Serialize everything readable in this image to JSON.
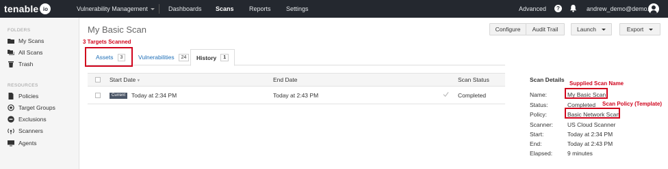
{
  "app": {
    "logo_text": "tenable",
    "logo_badge": "io",
    "product": "Vulnerability Management",
    "nav": [
      "Dashboards",
      "Scans",
      "Reports",
      "Settings"
    ],
    "advanced": "Advanced",
    "help_glyph": "?",
    "user": "andrew_demo@demo...",
    "icons": {
      "help": "help-icon",
      "notifications": "bell-icon",
      "user": "user-avatar-icon"
    }
  },
  "sidebar": {
    "folders_heading": "FOLDERS",
    "folders": [
      {
        "label": "My Scans",
        "icon": "folder-icon"
      },
      {
        "label": "All Scans",
        "icon": "folders-icon"
      },
      {
        "label": "Trash",
        "icon": "trash-icon"
      }
    ],
    "resources_heading": "RESOURCES",
    "resources": [
      {
        "label": "Policies",
        "icon": "document-icon"
      },
      {
        "label": "Target Groups",
        "icon": "target-icon"
      },
      {
        "label": "Exclusions",
        "icon": "minus-circle-icon"
      },
      {
        "label": "Scanners",
        "icon": "antenna-icon"
      },
      {
        "label": "Agents",
        "icon": "monitor-icon"
      }
    ]
  },
  "page": {
    "title": "My Basic Scan",
    "buttons": {
      "configure": "Configure",
      "audit_trail": "Audit Trail",
      "launch": "Launch",
      "export": "Export"
    }
  },
  "tabs": [
    {
      "label": "Assets",
      "count": "3"
    },
    {
      "label": "Vulnerabilities",
      "count": "24"
    },
    {
      "label": "History",
      "count": "1"
    }
  ],
  "history_table": {
    "columns": [
      "Start Date",
      "End Date",
      "Scan Status"
    ],
    "rows": [
      {
        "badge": "Current",
        "start": "Today at 2:34 PM",
        "end": "Today at 2:43 PM",
        "status": "Completed"
      }
    ]
  },
  "scan_details": {
    "heading": "Scan Details",
    "fields": [
      {
        "label": "Name:",
        "value": "My Basic Scan"
      },
      {
        "label": "Status:",
        "value": "Completed"
      },
      {
        "label": "Policy:",
        "value": "Basic Network Scan"
      },
      {
        "label": "Scanner:",
        "value": "US Cloud Scanner"
      },
      {
        "label": "Start:",
        "value": "Today at 2:34 PM"
      },
      {
        "label": "End:",
        "value": "Today at 2:43 PM"
      },
      {
        "label": "Elapsed:",
        "value": "9 minutes"
      }
    ]
  },
  "annotations": {
    "targets": "3 Targets Scanned",
    "scan_name": "Supplied Scan Name",
    "scan_policy": "Scan Policy (Template)",
    "color": "#d0021b"
  },
  "colors": {
    "topbar": "#24282f",
    "link": "#1e6fb8",
    "accent_red": "#d0021b"
  }
}
